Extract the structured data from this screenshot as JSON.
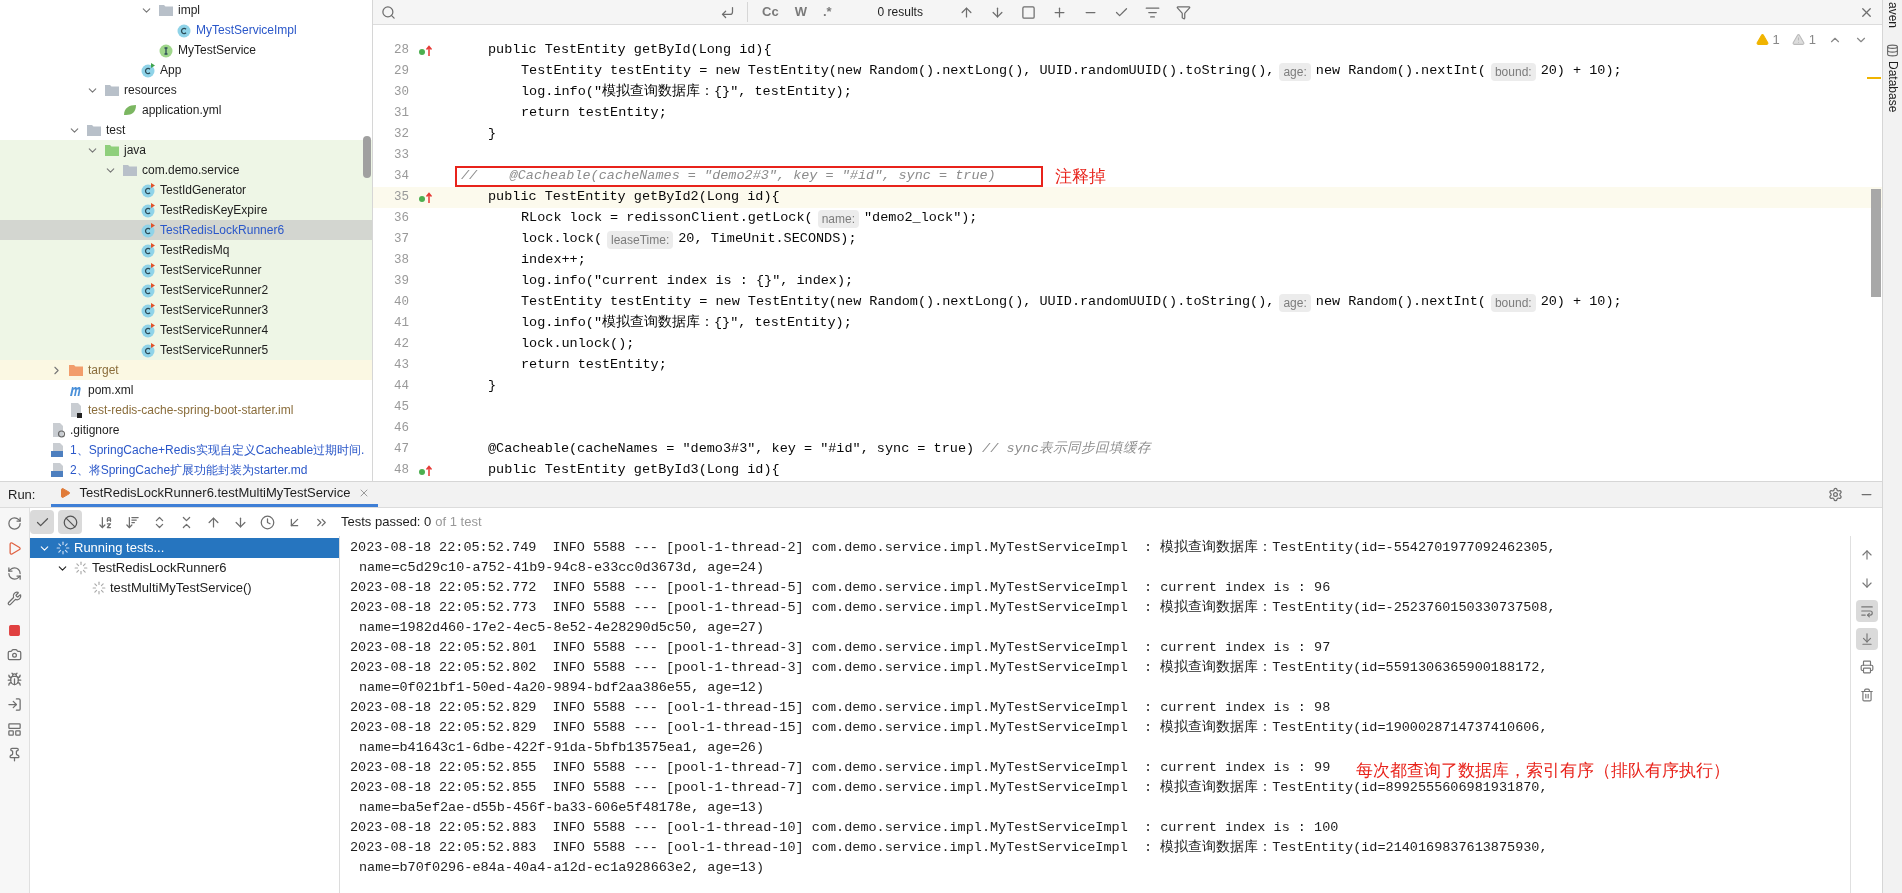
{
  "project_tree": [
    {
      "children": [
        {
          "children": [
            {
              "children": [
                {
                  "children": [
                    {
                      "children": [
                        {
                          "children": [
                            {
                              "label": "impl",
                              "kind": "package",
                              "expanded": true,
                              "selected": false,
                              "modified": false,
                              "ignored": false,
                              "test_source": false,
                              "children": [
                                {
                                  "label": "MyTestServiceImpl",
                                  "kind": "class",
                                  "selected": false,
                                  "modified": true,
                                  "ignored": false,
                                  "test_source": false
                                }
                              ]
                            },
                            {
                              "label": "MyTestService",
                              "kind": "interface",
                              "selected": false,
                              "modified": false,
                              "ignored": false,
                              "test_source": false
                            }
                          ]
                        },
                        {
                          "label": "App",
                          "kind": "app",
                          "selected": false,
                          "modified": false,
                          "ignored": false,
                          "test_source": false
                        }
                      ]
                    }
                  ]
                },
                {
                  "label": "resources",
                  "kind": "resources",
                  "expanded": true,
                  "selected": false,
                  "modified": false,
                  "ignored": false,
                  "test_source": false,
                  "children": [
                    {
                      "label": "application.yml",
                      "kind": "yml",
                      "selected": false,
                      "modified": false,
                      "ignored": false,
                      "test_source": false
                    }
                  ]
                }
              ]
            },
            {
              "label": "test",
              "kind": "folder",
              "expanded": true,
              "selected": false,
              "modified": false,
              "ignored": false,
              "test_source": false,
              "children": [
                {
                  "label": "java",
                  "kind": "testroot",
                  "expanded": true,
                  "selected": false,
                  "modified": false,
                  "ignored": false,
                  "test_source": true,
                  "children": [
                    {
                      "label": "com.demo.service",
                      "kind": "package",
                      "expanded": true,
                      "selected": false,
                      "modified": false,
                      "ignored": false,
                      "test_source": true,
                      "children": [
                        {
                          "label": "TestIdGenerator",
                          "kind": "testclass",
                          "selected": false,
                          "modified": false,
                          "ignored": false,
                          "test_source": true
                        },
                        {
                          "label": "TestRedisKeyExpire",
                          "kind": "testclass",
                          "selected": false,
                          "modified": false,
                          "ignored": false,
                          "test_source": true
                        },
                        {
                          "label": "TestRedisLockRunner6",
                          "kind": "testclass",
                          "selected": true,
                          "modified": true,
                          "ignored": false,
                          "test_source": true
                        },
                        {
                          "label": "TestRedisMq",
                          "kind": "testclass",
                          "selected": false,
                          "modified": false,
                          "ignored": false,
                          "test_source": true
                        },
                        {
                          "label": "TestServiceRunner",
                          "kind": "testclass",
                          "selected": false,
                          "modified": false,
                          "ignored": false,
                          "test_source": true
                        },
                        {
                          "label": "TestServiceRunner2",
                          "kind": "testclass",
                          "selected": false,
                          "modified": false,
                          "ignored": false,
                          "test_source": true
                        },
                        {
                          "label": "TestServiceRunner3",
                          "kind": "testclass",
                          "selected": false,
                          "modified": false,
                          "ignored": false,
                          "test_source": true
                        },
                        {
                          "label": "TestServiceRunner4",
                          "kind": "testclass",
                          "selected": false,
                          "modified": false,
                          "ignored": false,
                          "test_source": true
                        },
                        {
                          "label": "TestServiceRunner5",
                          "kind": "testclass",
                          "selected": false,
                          "modified": false,
                          "ignored": false,
                          "test_source": true
                        }
                      ]
                    }
                  ]
                }
              ]
            }
          ]
        },
        {
          "label": "target",
          "kind": "excluded",
          "expanded": false,
          "selected": false,
          "modified": false,
          "ignored": true,
          "test_source": false
        },
        {
          "label": "pom.xml",
          "kind": "maven",
          "selected": false,
          "modified": false,
          "ignored": false,
          "test_source": false
        },
        {
          "label": "test-redis-cache-spring-boot-starter.iml",
          "kind": "iml",
          "selected": false,
          "modified": false,
          "ignored": true,
          "test_source": false
        }
      ]
    },
    {
      "label": ".gitignore",
      "kind": "gitignore",
      "selected": false,
      "modified": false,
      "ignored": false,
      "test_source": false
    },
    {
      "label": "1、SpringCache+Redis实现自定义Cacheable过期时间.",
      "kind": "md",
      "selected": false,
      "modified": true,
      "ignored": false,
      "test_source": false
    },
    {
      "label": "2、将SpringCache扩展功能封装为starter.md",
      "kind": "md",
      "selected": false,
      "modified": true,
      "ignored": false,
      "test_source": false
    }
  ],
  "find_bar": {
    "options": [
      "Cc",
      "W",
      ".*"
    ],
    "results": "0 results"
  },
  "inspections": [
    {
      "kind": "warning",
      "count": "1"
    },
    {
      "kind": "weak",
      "count": "1"
    }
  ],
  "code_lines": [
    {
      "number": "28",
      "kind": "member",
      "override_marker": true,
      "current": false,
      "segments": [
        {
          "kind": "code",
          "text": "public TestEntity getById(Long id){"
        }
      ]
    },
    {
      "number": "29",
      "kind": "body",
      "override_marker": false,
      "current": false,
      "segments": [
        {
          "kind": "code",
          "text": "TestEntity testEntity = new TestEntity(new Random().nextLong(), UUID.randomUUID().toString(),"
        },
        {
          "kind": "hint",
          "text": "age:"
        },
        {
          "kind": "code",
          "text": "new Random().nextInt("
        },
        {
          "kind": "hint",
          "text": "bound:"
        },
        {
          "kind": "code",
          "text": "20) + 10);"
        }
      ]
    },
    {
      "number": "30",
      "kind": "body",
      "override_marker": false,
      "current": false,
      "segments": [
        {
          "kind": "code",
          "text": "log.info(\"模拟查询数据库：{}\", testEntity);"
        }
      ]
    },
    {
      "number": "31",
      "kind": "body",
      "override_marker": false,
      "current": false,
      "segments": [
        {
          "kind": "code",
          "text": "return testEntity;"
        }
      ]
    },
    {
      "number": "32",
      "kind": "member",
      "override_marker": false,
      "current": false,
      "segments": [
        {
          "kind": "code",
          "text": "}"
        }
      ]
    },
    {
      "number": "33",
      "kind": "member",
      "override_marker": false,
      "current": false
    },
    {
      "number": "34",
      "kind": "flush",
      "override_marker": false,
      "current": false,
      "boxed": true,
      "annotation": "注释掉",
      "segments": [
        {
          "kind": "comment",
          "text": "//    @Cacheable(cacheNames = \"demo2#3\", key = \"#id\", sync = true)"
        }
      ]
    },
    {
      "number": "35",
      "kind": "member",
      "override_marker": true,
      "current": true,
      "segments": [
        {
          "kind": "code",
          "text": "public TestEntity getById2(Long id){"
        }
      ]
    },
    {
      "number": "36",
      "kind": "body",
      "override_marker": false,
      "current": false,
      "segments": [
        {
          "kind": "code",
          "text": "RLock lock = redissonClient.getLock("
        },
        {
          "kind": "hint",
          "text": "name:"
        },
        {
          "kind": "code",
          "text": "\"demo2_lock\");"
        }
      ]
    },
    {
      "number": "37",
      "kind": "body",
      "override_marker": false,
      "current": false,
      "segments": [
        {
          "kind": "code",
          "text": "lock.lock("
        },
        {
          "kind": "hint",
          "text": "leaseTime:"
        },
        {
          "kind": "code",
          "text": "20, TimeUnit.SECONDS);"
        }
      ]
    },
    {
      "number": "38",
      "kind": "body",
      "override_marker": false,
      "current": false,
      "segments": [
        {
          "kind": "code",
          "text": "index++;"
        }
      ]
    },
    {
      "number": "39",
      "kind": "body",
      "override_marker": false,
      "current": false,
      "segments": [
        {
          "kind": "code",
          "text": "log.info(\"current index is : {}\", index);"
        }
      ]
    },
    {
      "number": "40",
      "kind": "body",
      "override_marker": false,
      "current": false,
      "segments": [
        {
          "kind": "code",
          "text": "TestEntity testEntity = new TestEntity(new Random().nextLong(), UUID.randomUUID().toString(),"
        },
        {
          "kind": "hint",
          "text": "age:"
        },
        {
          "kind": "code",
          "text": "new Random().nextInt("
        },
        {
          "kind": "hint",
          "text": "bound:"
        },
        {
          "kind": "code",
          "text": "20) + 10);"
        }
      ]
    },
    {
      "number": "41",
      "kind": "body",
      "override_marker": false,
      "current": false,
      "segments": [
        {
          "kind": "code",
          "text": "log.info(\"模拟查询数据库：{}\", testEntity);"
        }
      ]
    },
    {
      "number": "42",
      "kind": "body",
      "override_marker": false,
      "current": false,
      "segments": [
        {
          "kind": "code",
          "text": "lock.unlock();"
        }
      ]
    },
    {
      "number": "43",
      "kind": "body",
      "override_marker": false,
      "current": false,
      "segments": [
        {
          "kind": "code",
          "text": "return testEntity;"
        }
      ]
    },
    {
      "number": "44",
      "kind": "member",
      "override_marker": false,
      "current": false,
      "segments": [
        {
          "kind": "code",
          "text": "}"
        }
      ]
    },
    {
      "number": "45",
      "kind": "member",
      "override_marker": false,
      "current": false
    },
    {
      "number": "46",
      "kind": "member",
      "override_marker": false,
      "current": false
    },
    {
      "number": "47",
      "kind": "member",
      "override_marker": false,
      "current": false,
      "segments": [
        {
          "kind": "annotation",
          "text": "@Cacheable(cacheNames = \"demo3#3\", key = \"#id\", sync = true)"
        },
        {
          "kind": "comment",
          "text": "// sync表示同步回填缓存"
        }
      ]
    },
    {
      "number": "48",
      "kind": "member",
      "override_marker": true,
      "current": false,
      "segments": [
        {
          "kind": "code",
          "text": "public TestEntity getById3(Long id){"
        }
      ]
    }
  ],
  "side_tabs": [
    "aven",
    "Database"
  ],
  "run": {
    "label": "Run:",
    "tab": {
      "title": "TestRedisLockRunner6.testMultiMyTestService",
      "selected": true
    },
    "filters": [
      {
        "kind": "passed",
        "on": true
      },
      {
        "kind": "ignored",
        "on": true
      }
    ],
    "status": "Tests passed: 0",
    "status_total": "of 1 test",
    "tests": [
      {
        "label": "Running tests...",
        "selected": true,
        "expanded": true,
        "children": [
          {
            "label": "TestRedisLockRunner6",
            "selected": false,
            "expanded": true,
            "children": [
              {
                "label": "testMultiMyTestService()",
                "selected": false
              }
            ]
          }
        ]
      }
    ],
    "console": [
      {
        "kind": "log",
        "text": "2023-08-18 22:05:52.749  INFO 5588 --- [pool-1-thread-2] com.demo.service.impl.MyTestServiceImpl  : 模拟查询数据库：TestEntity(id=-5542701977092462305,"
      },
      {
        "kind": "cont",
        "text": "name=c5d29c10-a752-41b9-94c8-e33cc0d3673d, age=24)"
      },
      {
        "kind": "log",
        "text": "2023-08-18 22:05:52.772  INFO 5588 --- [pool-1-thread-5] com.demo.service.impl.MyTestServiceImpl  : current index is : 96"
      },
      {
        "kind": "log",
        "text": "2023-08-18 22:05:52.773  INFO 5588 --- [pool-1-thread-5] com.demo.service.impl.MyTestServiceImpl  : 模拟查询数据库：TestEntity(id=-2523760150330737508,"
      },
      {
        "kind": "cont",
        "text": "name=1982d460-17e2-4ec5-8e52-4e28290d5c50, age=27)"
      },
      {
        "kind": "log",
        "text": "2023-08-18 22:05:52.801  INFO 5588 --- [pool-1-thread-3] com.demo.service.impl.MyTestServiceImpl  : current index is : 97"
      },
      {
        "kind": "log",
        "text": "2023-08-18 22:05:52.802  INFO 5588 --- [pool-1-thread-3] com.demo.service.impl.MyTestServiceImpl  : 模拟查询数据库：TestEntity(id=5591306365900188172,"
      },
      {
        "kind": "cont",
        "text": "name=0f021bf1-50ed-4a20-9894-bdf2aa386e55, age=12)"
      },
      {
        "kind": "log",
        "text": "2023-08-18 22:05:52.829  INFO 5588 --- [ool-1-thread-15] com.demo.service.impl.MyTestServiceImpl  : current index is : 98"
      },
      {
        "kind": "log",
        "text": "2023-08-18 22:05:52.829  INFO 5588 --- [ool-1-thread-15] com.demo.service.impl.MyTestServiceImpl  : 模拟查询数据库：TestEntity(id=1900028714737410606,"
      },
      {
        "kind": "cont",
        "text": "name=b41643c1-6dbe-422f-91da-5bfb13575ea1, age=26)"
      },
      {
        "kind": "log",
        "text": "2023-08-18 22:05:52.855  INFO 5588 --- [pool-1-thread-7] com.demo.service.impl.MyTestServiceImpl  : current index is : 99"
      },
      {
        "kind": "log",
        "text": "2023-08-18 22:05:52.855  INFO 5588 --- [pool-1-thread-7] com.demo.service.impl.MyTestServiceImpl  : 模拟查询数据库：TestEntity(id=8992555606981931870,"
      },
      {
        "kind": "cont",
        "text": "name=ba5ef2ae-d55b-456f-ba33-606e5f48178e, age=13)"
      },
      {
        "kind": "log",
        "text": "2023-08-18 22:05:52.883  INFO 5588 --- [ool-1-thread-10] com.demo.service.impl.MyTestServiceImpl  : current index is : 100"
      },
      {
        "kind": "log",
        "text": "2023-08-18 22:05:52.883  INFO 5588 --- [ool-1-thread-10] com.demo.service.impl.MyTestServiceImpl  : 模拟查询数据库：TestEntity(id=2140169837613875930,"
      },
      {
        "kind": "cont",
        "text": "name=b70f0296-e84a-40a4-a12d-ec1a928663e2, age=13)"
      }
    ],
    "console_note": "每次都查询了数据库，索引有序（排队有序执行）",
    "side_actions": [
      {
        "kind": "up",
        "on": false
      },
      {
        "kind": "down",
        "on": false
      },
      {
        "kind": "wrap",
        "on": true
      },
      {
        "kind": "scrollend",
        "on": true
      },
      {
        "kind": "print",
        "on": false
      },
      {
        "kind": "clear",
        "on": false
      }
    ]
  }
}
